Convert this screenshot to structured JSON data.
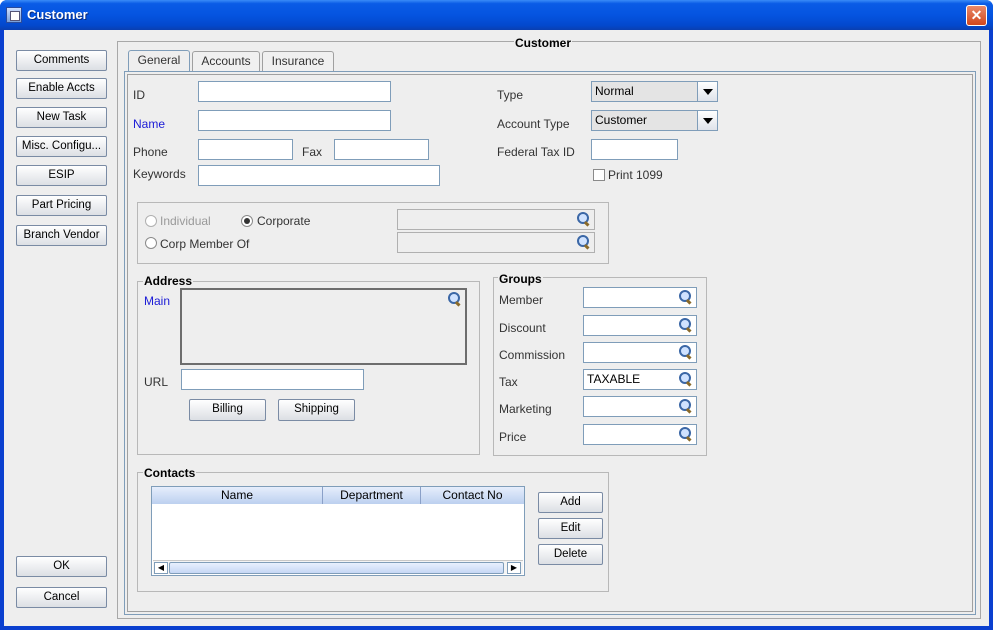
{
  "window": {
    "title": "Customer"
  },
  "sidebar": {
    "buttons": [
      "Comments",
      "Enable Accts",
      "New Task",
      "Misc. Configu...",
      "ESIP",
      "Part Pricing",
      "Branch Vendor"
    ],
    "ok": "OK",
    "cancel": "Cancel"
  },
  "panel": {
    "title": "Customer"
  },
  "tabs": [
    "General",
    "Accounts",
    "Insurance"
  ],
  "general": {
    "id_label": "ID",
    "id_value": "",
    "name_label": "Name",
    "name_value": "",
    "phone_label": "Phone",
    "phone_value": "",
    "fax_label": "Fax",
    "fax_value": "",
    "keywords_label": "Keywords",
    "keywords_value": "",
    "type_label": "Type",
    "type_value": "Normal",
    "account_type_label": "Account Type",
    "account_type_value": "Customer",
    "tax_id_label": "Federal Tax ID",
    "tax_id_value": "",
    "print1099_label": "Print 1099",
    "print1099_checked": false
  },
  "corp": {
    "individual_label": "Individual",
    "corporate_label": "Corporate",
    "corp_member_label": "Corp Member Of",
    "selected": "Corporate"
  },
  "address": {
    "title": "Address",
    "main_label": "Main",
    "main_value": "",
    "url_label": "URL",
    "url_value": "",
    "billing_button": "Billing",
    "shipping_button": "Shipping"
  },
  "groups": {
    "title": "Groups",
    "rows": [
      {
        "label": "Member",
        "value": ""
      },
      {
        "label": "Discount",
        "value": ""
      },
      {
        "label": "Commission",
        "value": ""
      },
      {
        "label": "Tax",
        "value": "TAXABLE"
      },
      {
        "label": "Marketing",
        "value": ""
      },
      {
        "label": "Price",
        "value": ""
      }
    ]
  },
  "contacts": {
    "title": "Contacts",
    "columns": [
      "Name",
      "Department",
      "Contact No"
    ],
    "rows": [],
    "add_button": "Add",
    "edit_button": "Edit",
    "delete_button": "Delete"
  },
  "colors": {
    "title_bar": "#0554e0",
    "accent_label": "#1b1bd6",
    "close_button": "#d2471d"
  }
}
